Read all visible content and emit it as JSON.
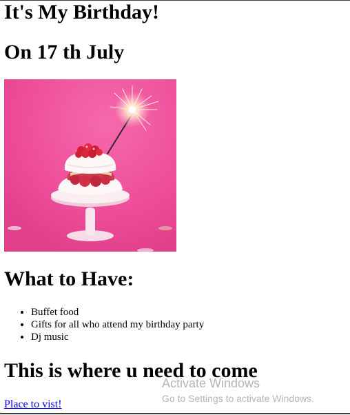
{
  "heading": {
    "title": "It's My Birthday!",
    "date": "On 17 th July"
  },
  "image": {
    "subject": "cake-with-sparkler",
    "background_color": "#ee4f9a"
  },
  "have_section": {
    "title": "What to Have:",
    "items": [
      "Buffet food",
      "Gifts for all who attend my birthday party",
      "Dj music"
    ]
  },
  "location_section": {
    "title": "This is where u need to come",
    "link_text": "Place to vist!",
    "link_color": "#0000ee"
  },
  "watermark": {
    "title": "Activate Windows",
    "subtitle": "Go to Settings to activate Windows."
  }
}
